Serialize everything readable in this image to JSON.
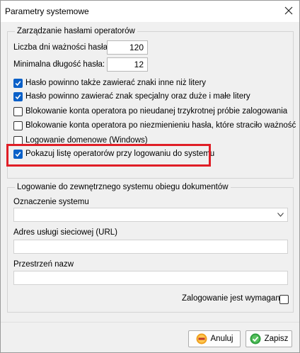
{
  "window": {
    "title": "Parametry systemowe"
  },
  "password_group": {
    "legend": "Zarządzanie hasłami operatorów",
    "validity_days_label": "Liczba dni ważności hasła:",
    "validity_days_value": "120",
    "min_length_label": "Minimalna długość hasła:",
    "min_length_value": "12",
    "options": [
      {
        "label": "Hasło powinno także zawierać znaki inne niż litery",
        "checked": true
      },
      {
        "label": "Hasło powinno zawierać znak specjalny oraz duże i małe litery",
        "checked": true
      },
      {
        "label": "Blokowanie konta operatora po nieudanej trzykrotnej próbie zalogowania",
        "checked": false
      },
      {
        "label": "Blokowanie konta operatora po niezmienieniu hasła, które straciło ważność",
        "checked": false
      },
      {
        "label": "Logowanie domenowe (Windows)",
        "checked": false
      },
      {
        "label": "Pokazuj listę operatorów przy  logowaniu do systemu",
        "checked": true
      }
    ]
  },
  "external_group": {
    "legend": "Logowanie do zewnętrznego systemu obiegu dokumentów",
    "system_label": "Oznaczenie systemu",
    "system_value": "",
    "url_label": "Adres usługi sieciowej (URL)",
    "url_value": "",
    "namespace_label": "Przestrzeń nazw",
    "namespace_value": "",
    "login_required_label": "Zalogowanie jest wymagane",
    "login_required_checked": false
  },
  "buttons": {
    "cancel": "Anuluj",
    "save": "Zapisz"
  },
  "colors": {
    "highlight": "#e01e26",
    "checkbox_checked": "#0a60c8"
  }
}
